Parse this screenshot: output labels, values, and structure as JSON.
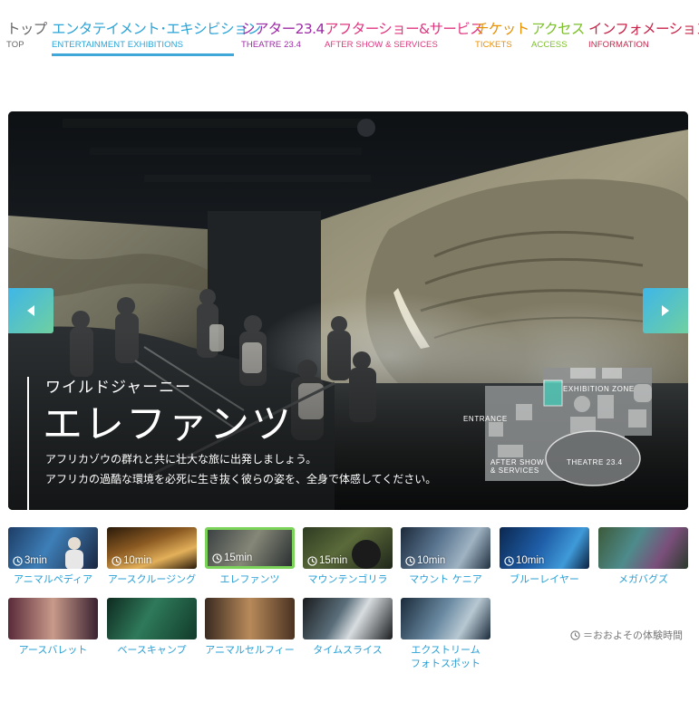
{
  "nav": [
    {
      "jp": "トップ",
      "en": "TOP",
      "color": "#666666",
      "active": false
    },
    {
      "jp": "エンタテイメント･エキシビション",
      "en": "ENTERTAINMENT EXHIBITIONS",
      "color": "#2aa4d8",
      "active": true
    },
    {
      "jp": "シアター23.4",
      "en": "THEATRE 23.4",
      "color": "#9d2aa6",
      "active": false
    },
    {
      "jp": "アフターショー&サービス",
      "en": "AFTER SHOW & SERVICES",
      "color": "#e0357f",
      "active": false
    },
    {
      "jp": "チケット",
      "en": "TICKETS",
      "color": "#e88f00",
      "active": false
    },
    {
      "jp": "アクセス",
      "en": "ACCESS",
      "color": "#7cc02a",
      "active": false
    },
    {
      "jp": "インフォメーション",
      "en": "INFORMATION",
      "color": "#c7244a",
      "active": false
    }
  ],
  "hero": {
    "subtitle": "ワイルドジャーニー",
    "title": "エレファンツ",
    "desc_line1": "アフリカゾウの群れと共に壮大な旅に出発しましょう。",
    "desc_line2": "アフリカの過酷な環境を必死に生き抜く彼らの姿を、全身で体感してください。",
    "map": {
      "exhibition_zone": "EXHIBITION ZONE",
      "entrance": "ENTRANCE",
      "after_show_1": "AFTER SHOW",
      "after_show_2": "& SERVICES",
      "theatre": "THEATRE 23.4"
    }
  },
  "thumbs": [
    {
      "label": "アニマルペディア",
      "duration": "3min",
      "active": false
    },
    {
      "label": "アースクルージング",
      "duration": "10min",
      "active": false
    },
    {
      "label": "エレファンツ",
      "duration": "15min",
      "active": true
    },
    {
      "label": "マウンテンゴリラ",
      "duration": "15min",
      "active": false
    },
    {
      "label": "マウント ケニア",
      "duration": "10min",
      "active": false
    },
    {
      "label": "ブルーレイヤー",
      "duration": "10min",
      "active": false
    },
    {
      "label": "メガバグズ",
      "duration": "",
      "active": false
    },
    {
      "label": "アースバレット",
      "duration": "",
      "active": false
    },
    {
      "label": "ベースキャンプ",
      "duration": "",
      "active": false
    },
    {
      "label": "アニマルセルフィー",
      "duration": "",
      "active": false
    },
    {
      "label": "タイムスライス",
      "duration": "",
      "active": false
    },
    {
      "label": "エクストリーム",
      "label2": "フォトスポット",
      "duration": "",
      "active": false
    }
  ],
  "legend": "＝おおよその体験時間"
}
